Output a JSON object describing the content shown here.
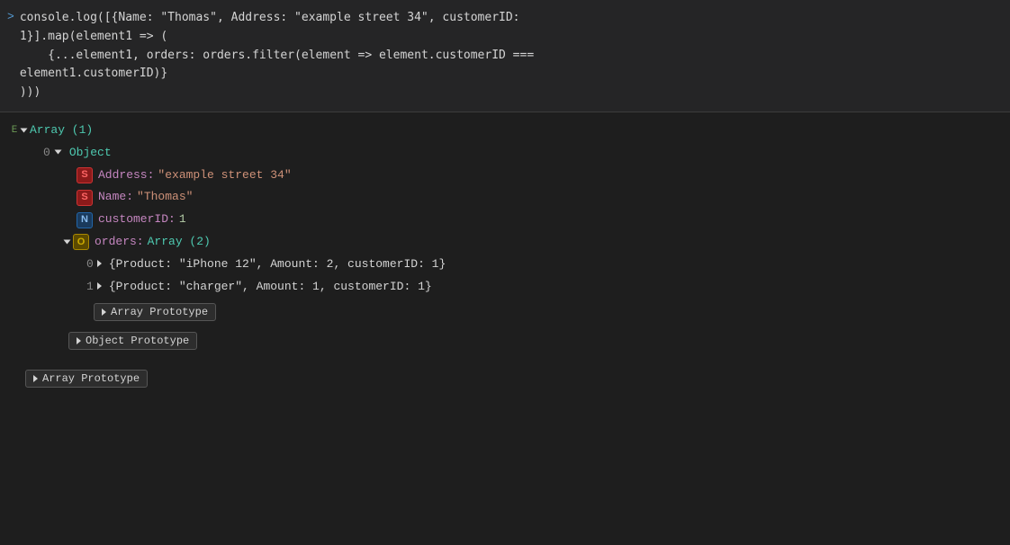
{
  "console": {
    "prompt_symbol": ">",
    "input_code": "console.log([{Name: \"Thomas\", Address: \"example street 34\", customerID:\n1}].map(element1 => (\n    {...element1, orders: orders.filter(element => element.customerID ===\nelement1.customerID)}\n)))",
    "log_icon": "E"
  },
  "output": {
    "array_label": "Array (1)",
    "index_0": "0",
    "object_label": "Object",
    "address_key": "Address:",
    "address_value": "\"example street 34\"",
    "name_key": "Name:",
    "name_value": "\"Thomas\"",
    "customer_id_key": "customerID:",
    "customer_id_value": "1",
    "orders_key": "orders:",
    "orders_label": "Array (2)",
    "order_0_index": "0",
    "order_0_value": "{Product: \"iPhone 12\", Amount: 2, customerID: 1}",
    "order_1_index": "1",
    "order_1_value": "{Product: \"charger\", Amount: 1, customerID: 1}",
    "array_prototype_inner": "Array Prototype",
    "object_prototype": "Object Prototype",
    "array_prototype_outer": "Array Prototype"
  },
  "badges": {
    "string": "S",
    "number": "N",
    "object": "O"
  }
}
